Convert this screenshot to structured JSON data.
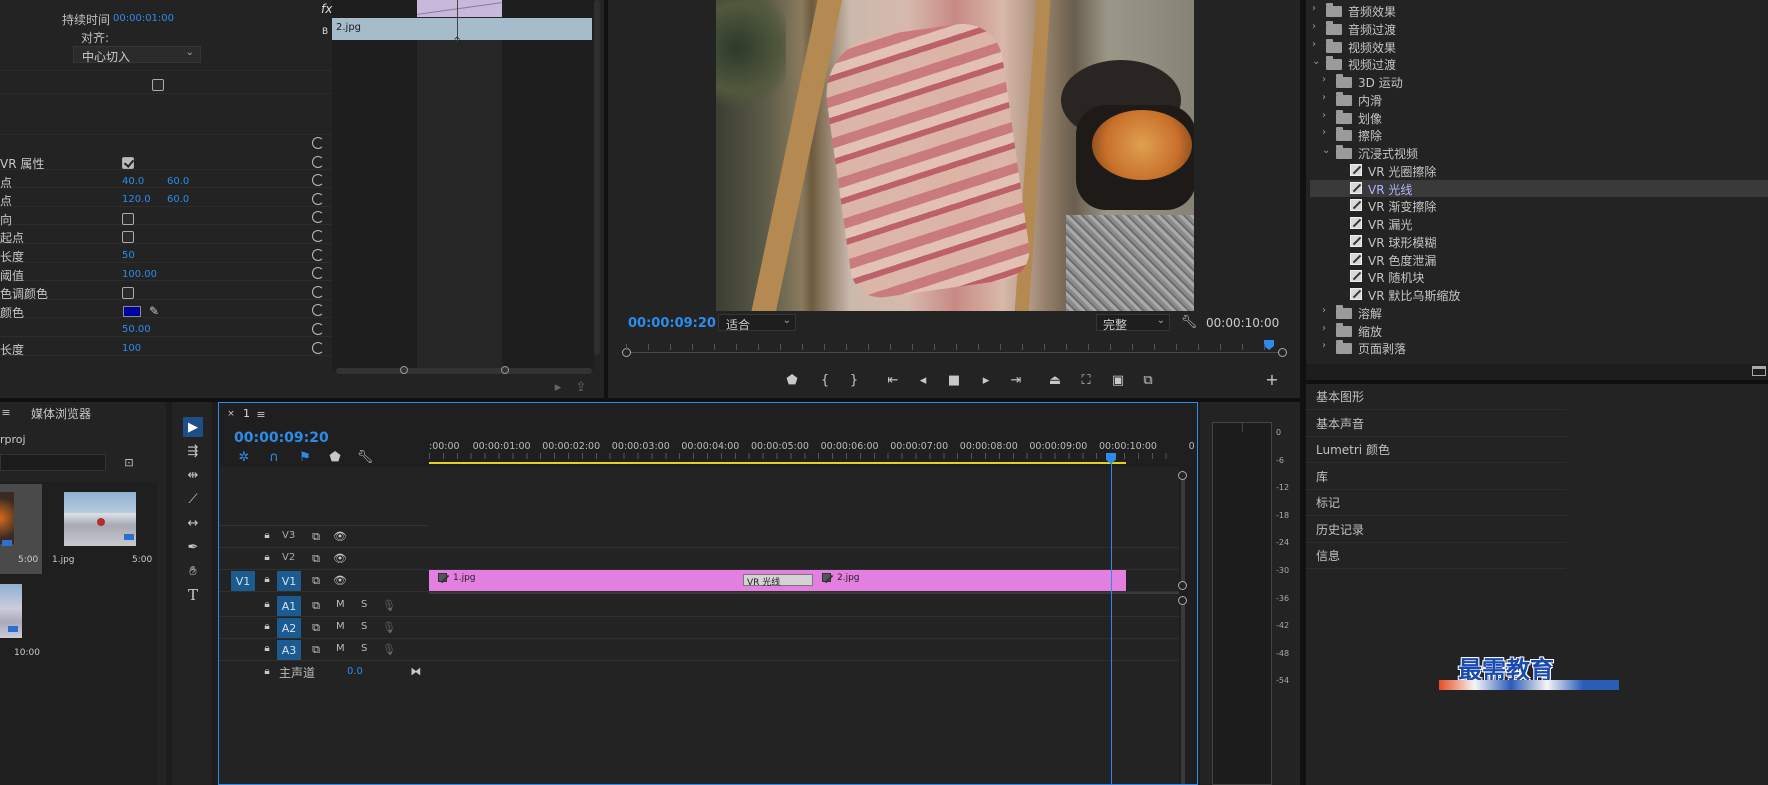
{
  "effect_controls": {
    "duration_label": "持续时间",
    "duration_value": "00:00:01:00",
    "align_label": "对齐:",
    "align_value": "中心切入",
    "fx_label": "fx",
    "clip_b_label": "B",
    "clip_b_name": "2.jpg",
    "props": [
      {
        "label": "VR 属性",
        "kind": "checkbox",
        "checked": true
      },
      {
        "label": "点",
        "v1": "40.0",
        "v2": "60.0"
      },
      {
        "label": "点",
        "v1": "120.0",
        "v2": "60.0"
      },
      {
        "label": "向",
        "kind": "checkbox",
        "checked": false
      },
      {
        "label": "起点",
        "kind": "checkbox",
        "checked": false
      },
      {
        "label": "长度",
        "v1": "50"
      },
      {
        "label": "阈值",
        "v1": "100.00"
      },
      {
        "label": "色调颜色",
        "kind": "checkbox",
        "checked": false
      },
      {
        "label": "颜色",
        "kind": "color",
        "color": "#0000a0"
      },
      {
        "label": "",
        "v1": "50.00"
      },
      {
        "label": "长度",
        "v1": "100"
      }
    ]
  },
  "program_monitor": {
    "timecode": "00:00:09:20",
    "fit_value": "适合",
    "quality_value": "完整",
    "duration": "00:00:10:00"
  },
  "effects_panel": {
    "items": [
      {
        "label": "音频效果",
        "level": 0,
        "type": "folder",
        "open": false
      },
      {
        "label": "音频过渡",
        "level": 0,
        "type": "folder",
        "open": false
      },
      {
        "label": "视频效果",
        "level": 0,
        "type": "folder",
        "open": false
      },
      {
        "label": "视频过渡",
        "level": 0,
        "type": "folder",
        "open": true
      },
      {
        "label": "3D 运动",
        "level": 1,
        "type": "folder",
        "open": false
      },
      {
        "label": "内滑",
        "level": 1,
        "type": "folder",
        "open": false
      },
      {
        "label": "划像",
        "level": 1,
        "type": "folder",
        "open": false
      },
      {
        "label": "擦除",
        "level": 1,
        "type": "folder",
        "open": false
      },
      {
        "label": "沉浸式视频",
        "level": 1,
        "type": "folder",
        "open": true
      },
      {
        "label": "VR 光圈擦除",
        "level": 2,
        "type": "effect"
      },
      {
        "label": "VR 光线",
        "level": 2,
        "type": "effect",
        "selected": true
      },
      {
        "label": "VR 渐变擦除",
        "level": 2,
        "type": "effect"
      },
      {
        "label": "VR 漏光",
        "level": 2,
        "type": "effect"
      },
      {
        "label": "VR 球形模糊",
        "level": 2,
        "type": "effect"
      },
      {
        "label": "VR 色度泄漏",
        "level": 2,
        "type": "effect"
      },
      {
        "label": "VR 随机块",
        "level": 2,
        "type": "effect"
      },
      {
        "label": "VR 默比乌斯缩放",
        "level": 2,
        "type": "effect"
      },
      {
        "label": "溶解",
        "level": 1,
        "type": "folder",
        "open": false
      },
      {
        "label": "缩放",
        "level": 1,
        "type": "folder",
        "open": false
      },
      {
        "label": "页面剥落",
        "level": 1,
        "type": "folder",
        "open": false
      }
    ]
  },
  "side_panels": [
    "基本图形",
    "基本声音",
    "Lumetri 颜色",
    "库",
    "标记",
    "历史记录",
    "信息"
  ],
  "project_panel": {
    "tab": "媒体浏览器",
    "project_name": "rproj",
    "thumbs": [
      {
        "name": "",
        "duration": "5:00"
      },
      {
        "name": "1.jpg",
        "duration": "5:00"
      },
      {
        "name": "",
        "duration": "10:00"
      }
    ]
  },
  "timeline": {
    "sequence_name": "1",
    "timecode": "00:00:09:20",
    "ruler": [
      ":00:00",
      "00:00:01:00",
      "00:00:02:00",
      "00:00:03:00",
      "00:00:04:00",
      "00:00:05:00",
      "00:00:06:00",
      "00:00:07:00",
      "00:00:08:00",
      "00:00:09:00",
      "00:00:10:00",
      "0"
    ],
    "video_tracks": [
      "V3",
      "V2",
      "V1"
    ],
    "audio_tracks": [
      "A1",
      "A2",
      "A3"
    ],
    "source_patch_v": "V1",
    "mute_label": "M",
    "solo_label": "S",
    "master_label": "主声道",
    "master_value": "0.0",
    "clip1": "1.jpg",
    "clip2": "2.jpg",
    "transition": "VR 光线"
  },
  "meter_scale": [
    "0",
    "-6",
    "-12",
    "-18",
    "-24",
    "-30",
    "-36",
    "-42",
    "-48",
    "-54"
  ],
  "watermark": "最需教育"
}
